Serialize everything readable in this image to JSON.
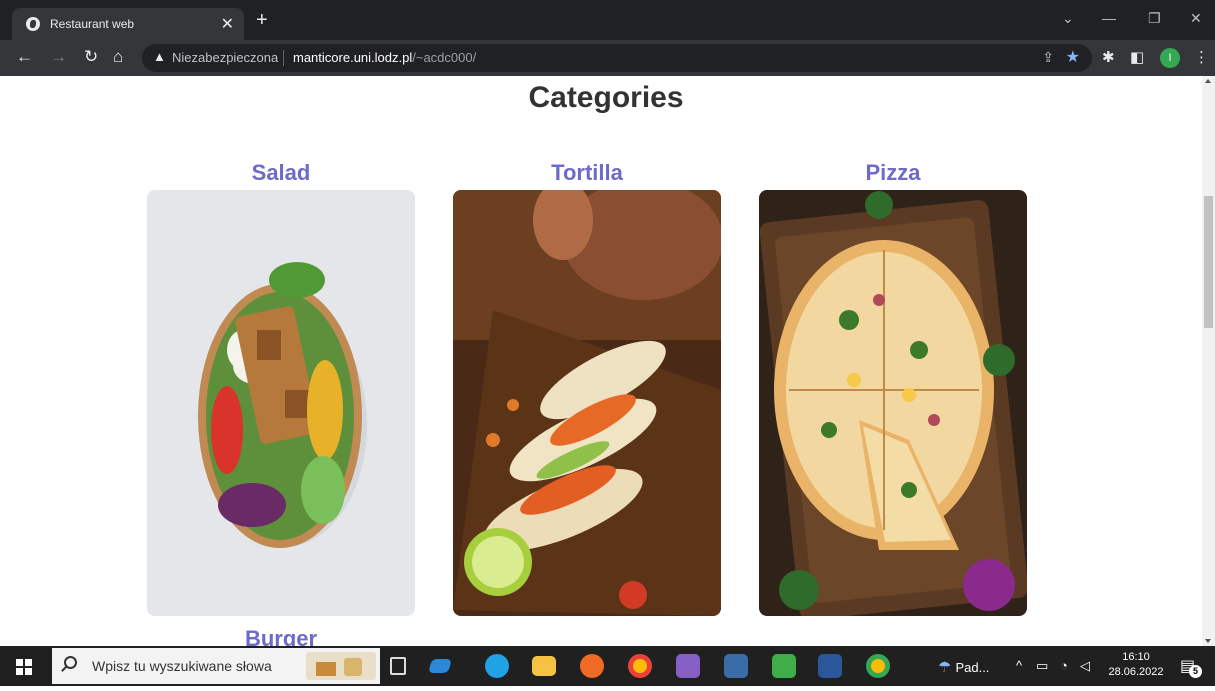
{
  "browser": {
    "tab_title": "Restaurant web",
    "tab_close": "✕",
    "new_tab": "+",
    "insecure_label": "Niezabezpieczona",
    "url_host": "manticore.uni.lodz.pl",
    "url_path": "/~acdc000/",
    "profile_initial": "I"
  },
  "page": {
    "title": "Categories",
    "categories": [
      {
        "name": "Salad"
      },
      {
        "name": "Tortilla"
      },
      {
        "name": "Pizza"
      },
      {
        "name": "Burger"
      }
    ]
  },
  "taskbar": {
    "search_placeholder": "Wpisz tu wyszukiwane słowa",
    "weather_label": "Pad...",
    "time": "16:10",
    "date": "28.06.2022",
    "notification_count": "5"
  }
}
